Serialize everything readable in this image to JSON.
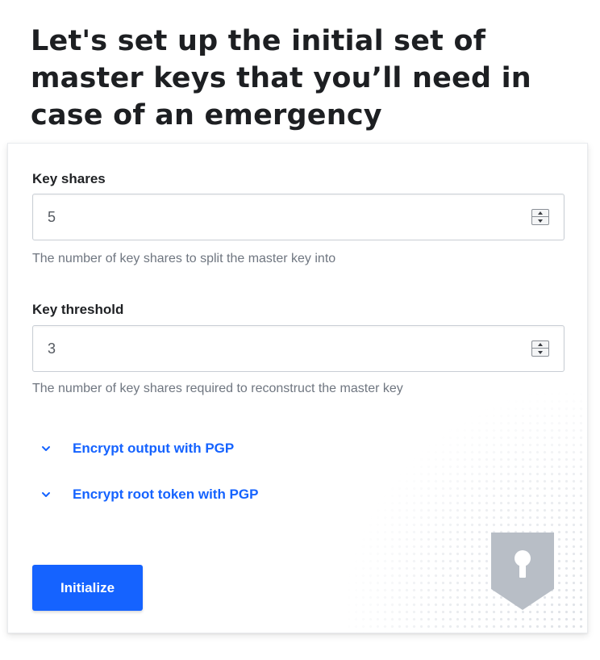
{
  "page": {
    "heading": "Let's set up the initial set of master keys that you’ll need in case of an emergency"
  },
  "form": {
    "key_shares": {
      "label": "Key shares",
      "value": "5",
      "help": "The number of key shares to split the master key into"
    },
    "key_threshold": {
      "label": "Key threshold",
      "value": "3",
      "help": "The number of key shares required to reconstruct the master key"
    },
    "toggles": [
      {
        "label": "Encrypt output with PGP",
        "icon": "chevron-down-icon"
      },
      {
        "label": "Encrypt root token with PGP",
        "icon": "chevron-down-icon"
      }
    ],
    "submit_label": "Initialize"
  },
  "decor": {
    "icon": "keyhole-shield-icon"
  },
  "colors": {
    "accent": "#1563ff",
    "heading": "#1d1f22",
    "help_text": "#6f7680",
    "shield": "#b8bec6"
  }
}
